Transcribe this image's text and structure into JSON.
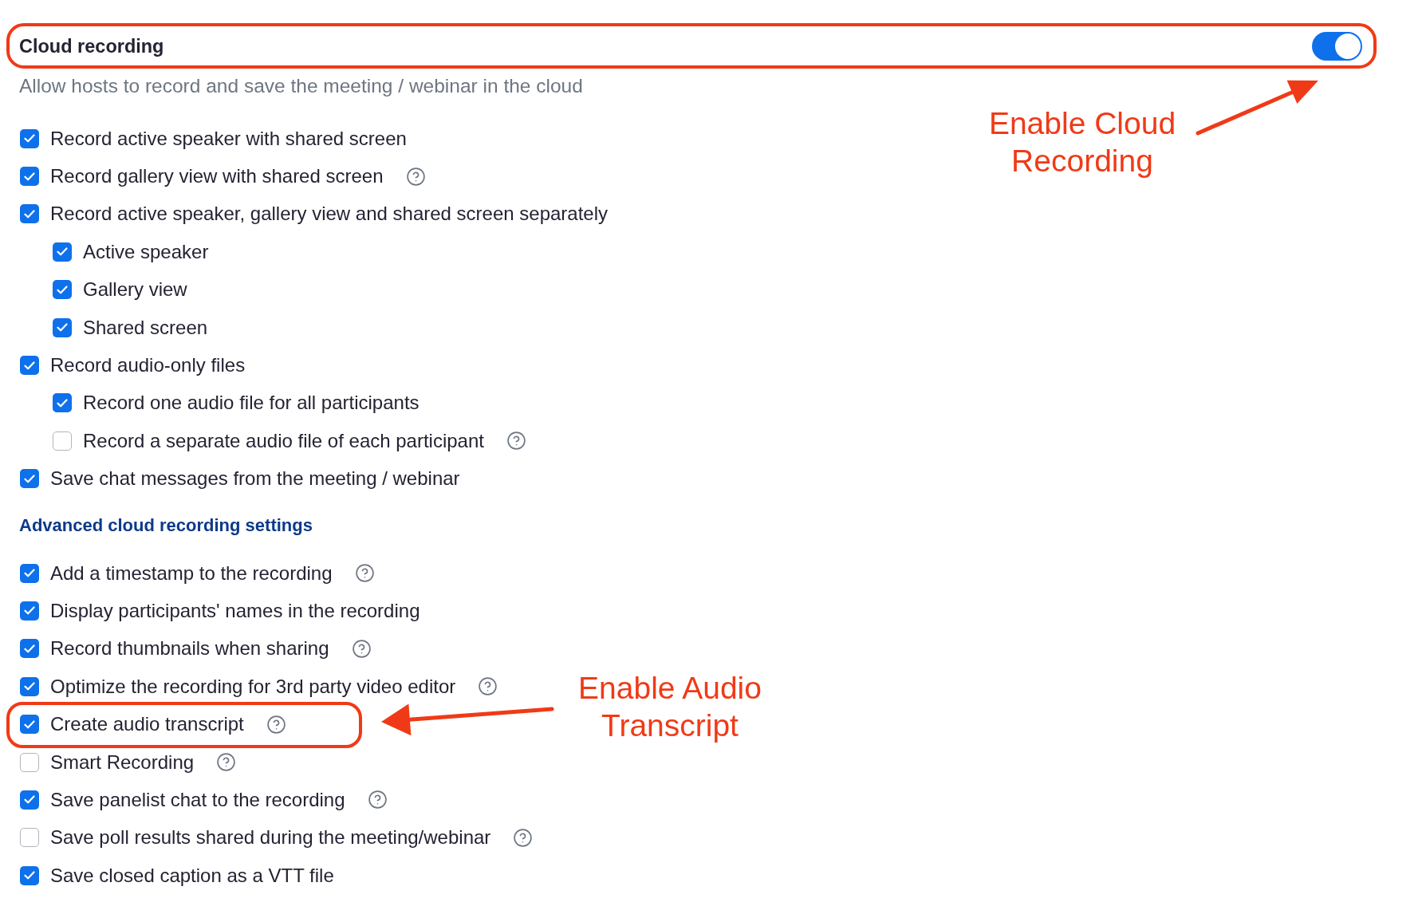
{
  "setting": {
    "title": "Cloud recording",
    "on": true,
    "description": "Allow hosts to record and save the meeting / webinar in the cloud",
    "note": "Enable Cloud Recording"
  },
  "options": [
    {
      "label": "Record active speaker with shared screen",
      "checked": true,
      "help": false
    },
    {
      "label": "Record gallery view with shared screen",
      "checked": true,
      "help": true
    },
    {
      "label": "Record active speaker, gallery view and shared screen separately",
      "checked": true,
      "help": false,
      "children": [
        {
          "label": "Active speaker",
          "checked": true,
          "help": false
        },
        {
          "label": "Gallery view",
          "checked": true,
          "help": false
        },
        {
          "label": "Shared screen",
          "checked": true,
          "help": false
        }
      ]
    },
    {
      "label": "Record audio-only files",
      "checked": true,
      "help": false,
      "children": [
        {
          "label": "Record one audio file for all participants",
          "checked": true,
          "help": false
        },
        {
          "label": "Record a separate audio file of each participant",
          "checked": false,
          "help": true
        }
      ]
    },
    {
      "label": "Save chat messages from the meeting / webinar",
      "checked": true,
      "help": false
    }
  ],
  "advanced": {
    "heading": "Advanced cloud recording settings",
    "options": [
      {
        "label": "Add a timestamp to the recording",
        "checked": true,
        "help": true
      },
      {
        "label": "Display participants' names in the recording",
        "checked": true,
        "help": false
      },
      {
        "label": "Record thumbnails when sharing",
        "checked": true,
        "help": true
      },
      {
        "label": "Optimize the recording for 3rd party video editor",
        "checked": true,
        "help": true
      },
      {
        "label": "Create audio transcript",
        "checked": true,
        "help": true,
        "note": "Enable Audio Transcript"
      },
      {
        "label": "Smart Recording",
        "checked": false,
        "help": true
      },
      {
        "label": "Save panelist chat to the recording",
        "checked": true,
        "help": true
      },
      {
        "label": "Save poll results shared during the meeting/webinar",
        "checked": false,
        "help": true
      },
      {
        "label": "Save closed caption as a VTT file",
        "checked": true,
        "help": false
      }
    ]
  }
}
